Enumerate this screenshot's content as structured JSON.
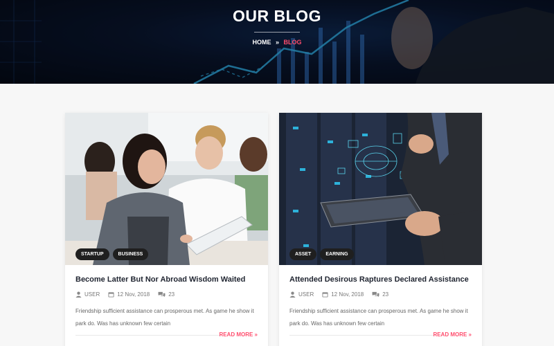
{
  "hero": {
    "title": "OUR BLOG",
    "breadcrumb": {
      "home": "HOME",
      "separator": "»",
      "current": "BLOG"
    },
    "accent_color": "#ff4d6d"
  },
  "posts": [
    {
      "image": "students-with-tablet-photo",
      "tags": [
        "STARTUP",
        "BUSINESS"
      ],
      "title": "Become Latter But Nor Abroad Wisdom Waited",
      "author": "USER",
      "date": "12 Nov, 2018",
      "comments": "23",
      "excerpt": "Friendship sufficient assistance can prosperous met. As game he show it park do. Was has unknown few certain",
      "read_more": "READ MORE »"
    },
    {
      "image": "businessman-tablet-server-room-photo",
      "tags": [
        "ASSET",
        "EARNING"
      ],
      "title": "Attended Desirous Raptures Declared Assistance",
      "author": "USER",
      "date": "12 Nov, 2018",
      "comments": "23",
      "excerpt": "Friendship sufficient assistance can prosperous met. As game he show it park do. Was has unknown few certain",
      "read_more": "READ MORE »"
    }
  ]
}
